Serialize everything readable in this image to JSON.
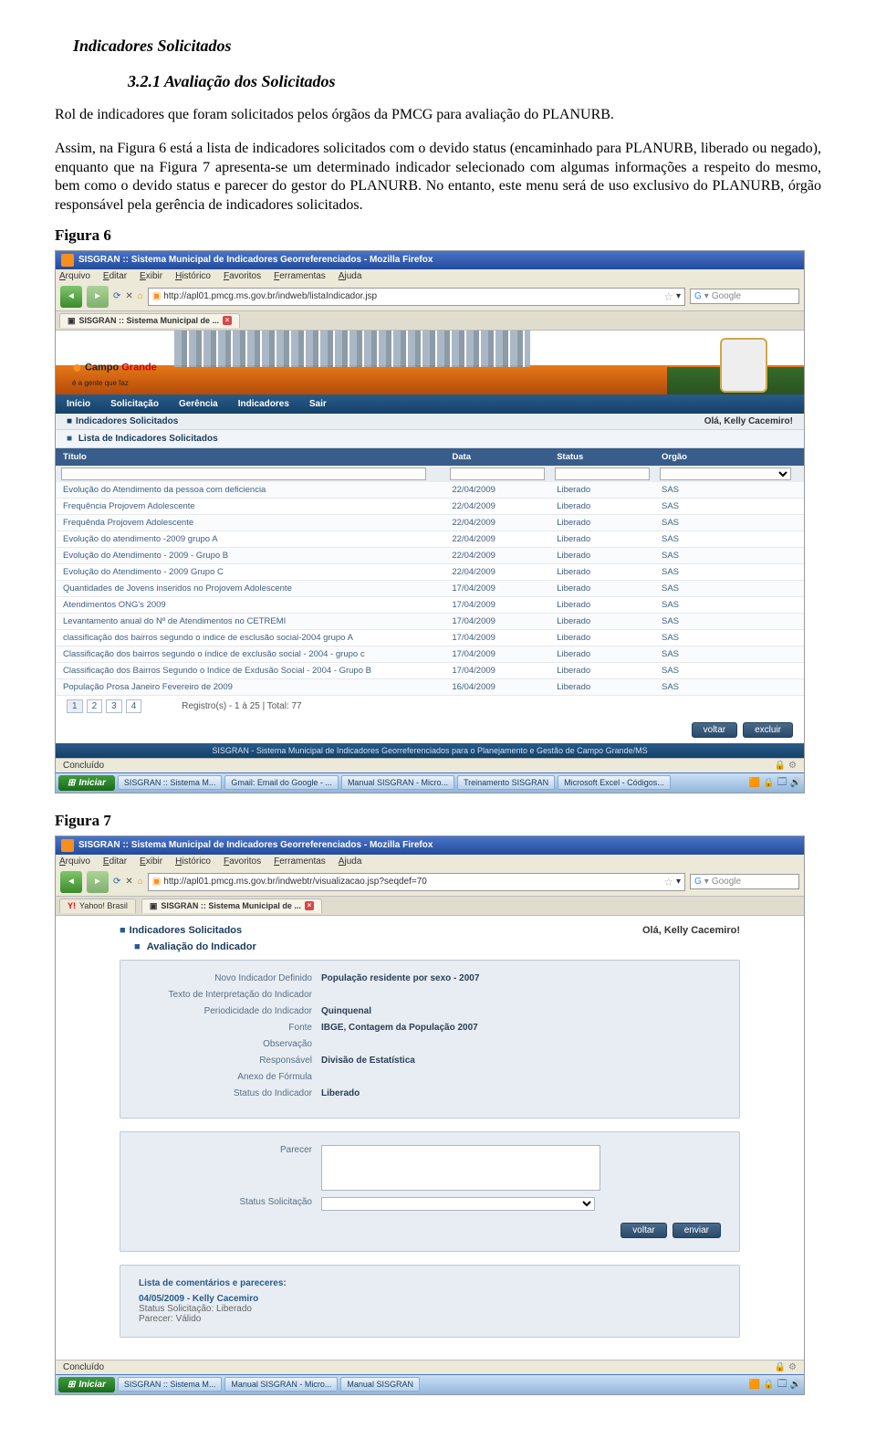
{
  "headings": {
    "h3": "Indicadores Solicitados",
    "h4": "3.2.1 Avaliação dos Solicitados"
  },
  "paragraphs": {
    "p1": "Rol de indicadores que foram solicitados pelos órgãos da PMCG para avaliação do PLANURB.",
    "p2": "Assim, na Figura 6 está a lista de indicadores solicitados com o devido status (encaminhado para PLANURB, liberado ou negado), enquanto que na Figura 7 apresenta-se um determinado indicador selecionado com algumas informações a respeito do mesmo, bem como o devido status e parecer do gestor do PLANURB. No entanto, este menu será de uso exclusivo do PLANURB, órgão responsável pela gerência de indicadores solicitados."
  },
  "fig6": {
    "label": "Figura 6",
    "window_title": "SISGRAN :: Sistema Municipal de Indicadores Georreferenciados - Mozilla Firefox",
    "menubar": [
      "Arquivo",
      "Editar",
      "Exibir",
      "Histórico",
      "Favoritos",
      "Ferramentas",
      "Ajuda"
    ],
    "url": "http://apl01.pmcg.ms.gov.br/indweb/listaIndicador.jsp",
    "search_placeholder": "Google",
    "tab": "SISGRAN :: Sistema Municipal de ...",
    "logo_text_1": "Campo",
    "logo_text_2": "Grande",
    "logo_sub": "é a gente que faz",
    "nav": [
      "Início",
      "Solicitação",
      "Gerência",
      "Indicadores",
      "Sair"
    ],
    "section": "Indicadores Solicitados",
    "hello": "Olá, Kelly Cacemiro!",
    "subsection": "Lista de Indicadores Solicitados",
    "columns": [
      "Título",
      "Data",
      "Status",
      "Orgão"
    ],
    "rows": [
      [
        "Evolução do Atendimento da pessoa com deficiencia",
        "22/04/2009",
        "Liberado",
        "SAS"
      ],
      [
        "Frequência Projovem Adolescente",
        "22/04/2009",
        "Liberado",
        "SAS"
      ],
      [
        "Frequênda Projovem Adolescente",
        "22/04/2009",
        "Liberado",
        "SAS"
      ],
      [
        "Evolução do atendimento -2009 grupo A",
        "22/04/2009",
        "Liberado",
        "SAS"
      ],
      [
        "Evolução do Atendimento - 2009 - Grupo B",
        "22/04/2009",
        "Liberado",
        "SAS"
      ],
      [
        "Evolução do Atendimento - 2009 Grupo C",
        "22/04/2009",
        "Liberado",
        "SAS"
      ],
      [
        "Quantidades de Jovens inseridos no Projovem Adolescente",
        "17/04/2009",
        "Liberado",
        "SAS"
      ],
      [
        "Atendimentos ONG's 2009",
        "17/04/2009",
        "Liberado",
        "SAS"
      ],
      [
        "Levantamento anual do Nº de Atendimentos no CETREMI",
        "17/04/2009",
        "Liberado",
        "SAS"
      ],
      [
        "classificação dos bairros segundo o indice de esclusão social-2004 grupo A",
        "17/04/2009",
        "Liberado",
        "SAS"
      ],
      [
        "Classificação dos bairros segundo o índice de exclusão social - 2004 - grupo c",
        "17/04/2009",
        "Liberado",
        "SAS"
      ],
      [
        "Classificação dos Bairros Segundo o Indice de Exdusão Social - 2004 - Grupo B",
        "17/04/2009",
        "Liberado",
        "SAS"
      ],
      [
        "População Prosa Janeiro Fevereiro de 2009",
        "16/04/2009",
        "Liberado",
        "SAS"
      ]
    ],
    "pager": [
      "1",
      "2",
      "3",
      "4"
    ],
    "pager_stats": "Registro(s) - 1 à 25 | Total: 77",
    "btn_back": "voltar",
    "btn_del": "excluir",
    "footer": "SISGRAN - Sistema Municipal de Indicadores Georreferenciados para o Planejamento e Gestão de Campo Grande/MS",
    "status": "Concluído",
    "taskbar": {
      "start": "Iniciar",
      "items": [
        "SISGRAN :: Sistema M...",
        "Gmail: Email do Google - ...",
        "Manual SISGRAN - Micro...",
        "Treinamento SISGRAN",
        "Microsoft Excel - Códigos..."
      ]
    }
  },
  "fig7": {
    "label": "Figura 7",
    "window_title": "SISGRAN :: Sistema Municipal de Indicadores Georreferenciados - Mozilla Firefox",
    "menubar": [
      "Arquivo",
      "Editar",
      "Exibir",
      "Histórico",
      "Favoritos",
      "Ferramentas",
      "Ajuda"
    ],
    "url": "http://apl01.pmcg.ms.gov.br/indwebtr/visualizacao.jsp?seqdef=70",
    "search_placeholder": "Google",
    "tabs": [
      {
        "label": "Yahoo! Brasil",
        "type": "yahoo"
      },
      {
        "label": "SISGRAN :: Sistema Municipal de ...",
        "type": "active"
      }
    ],
    "breadcrumb": "Indicadores Solicitados",
    "hello": "Olá, Kelly Cacemiro!",
    "subsection": "Avaliação do Indicador",
    "fields": [
      {
        "label": "Novo Indicador Definido",
        "value": "População residente por sexo - 2007"
      },
      {
        "label": "Texto de Interpretação do Indicador",
        "value": ""
      },
      {
        "label": "Periodicidade do Indicador",
        "value": "Quinquenal"
      },
      {
        "label": "Fonte",
        "value": "IBGE, Contagem da População 2007"
      },
      {
        "label": "Observação",
        "value": ""
      },
      {
        "label": "Responsável",
        "value": "Divisão de Estatística"
      },
      {
        "label": "Anexo de Fórmula",
        "value": ""
      },
      {
        "label": "Status do Indicador",
        "value": "Liberado"
      }
    ],
    "parecer_label": "Parecer",
    "status_label": "Status Solicitação",
    "btn_back": "voltar",
    "btn_send": "enviar",
    "comments_header": "Lista de comentários e pareceres:",
    "comment_date": "04/05/2009 - Kelly Cacemiro",
    "comment_status": "Status Solicitação: Liberado",
    "comment_parecer": "Parecer: Válido",
    "status": "Concluído",
    "taskbar": {
      "start": "Iniciar",
      "items": [
        "SISGRAN :: Sistema M...",
        "Manual SISGRAN - Micro...",
        "Manual SISGRAN"
      ]
    }
  }
}
